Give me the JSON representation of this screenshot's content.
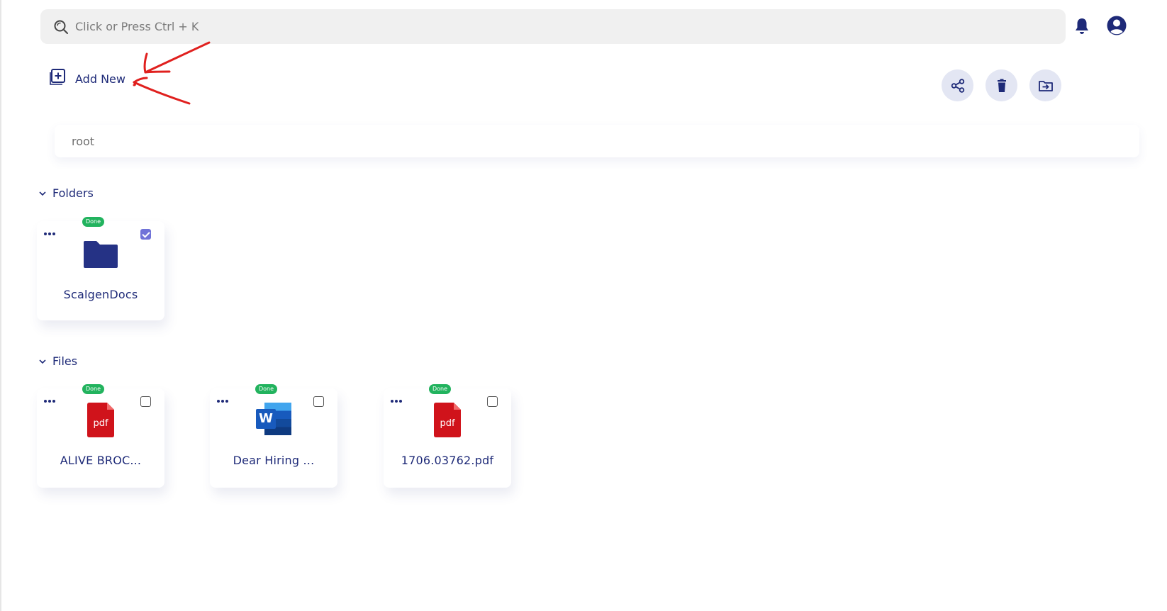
{
  "search": {
    "placeholder": "Click or Press Ctrl + K"
  },
  "toolbar": {
    "add_new_label": "Add New"
  },
  "breadcrumb": {
    "path": "root"
  },
  "folders_section": {
    "title": "Folders",
    "items": [
      {
        "name": "ScalgenDocs",
        "badge": "Done",
        "checked": true,
        "icon": "folder-icon"
      }
    ]
  },
  "files_section": {
    "title": "Files",
    "items": [
      {
        "name": "ALIVE BROC...",
        "badge": "Done",
        "checked": false,
        "icon": "pdf-file-icon",
        "icon_text": "pdf"
      },
      {
        "name": "Dear Hiring ...",
        "badge": "Done",
        "checked": false,
        "icon": "word-file-icon",
        "icon_text": "W"
      },
      {
        "name": "1706.03762.pdf",
        "badge": "Done",
        "checked": false,
        "icon": "pdf-file-icon",
        "icon_text": "pdf"
      }
    ]
  },
  "colors": {
    "primary": "#1e2a78",
    "badge_green": "#22b35e",
    "pdf_red": "#d0131b",
    "word_blue": "#185abd",
    "action_bg": "#e3e6f3",
    "annotation_red": "#e0201e"
  },
  "icons": [
    "search-icon",
    "bell-icon",
    "user-icon",
    "plus-square-icon",
    "share-icon",
    "trash-icon",
    "move-folder-icon",
    "chevron-down-icon",
    "more-icon"
  ]
}
